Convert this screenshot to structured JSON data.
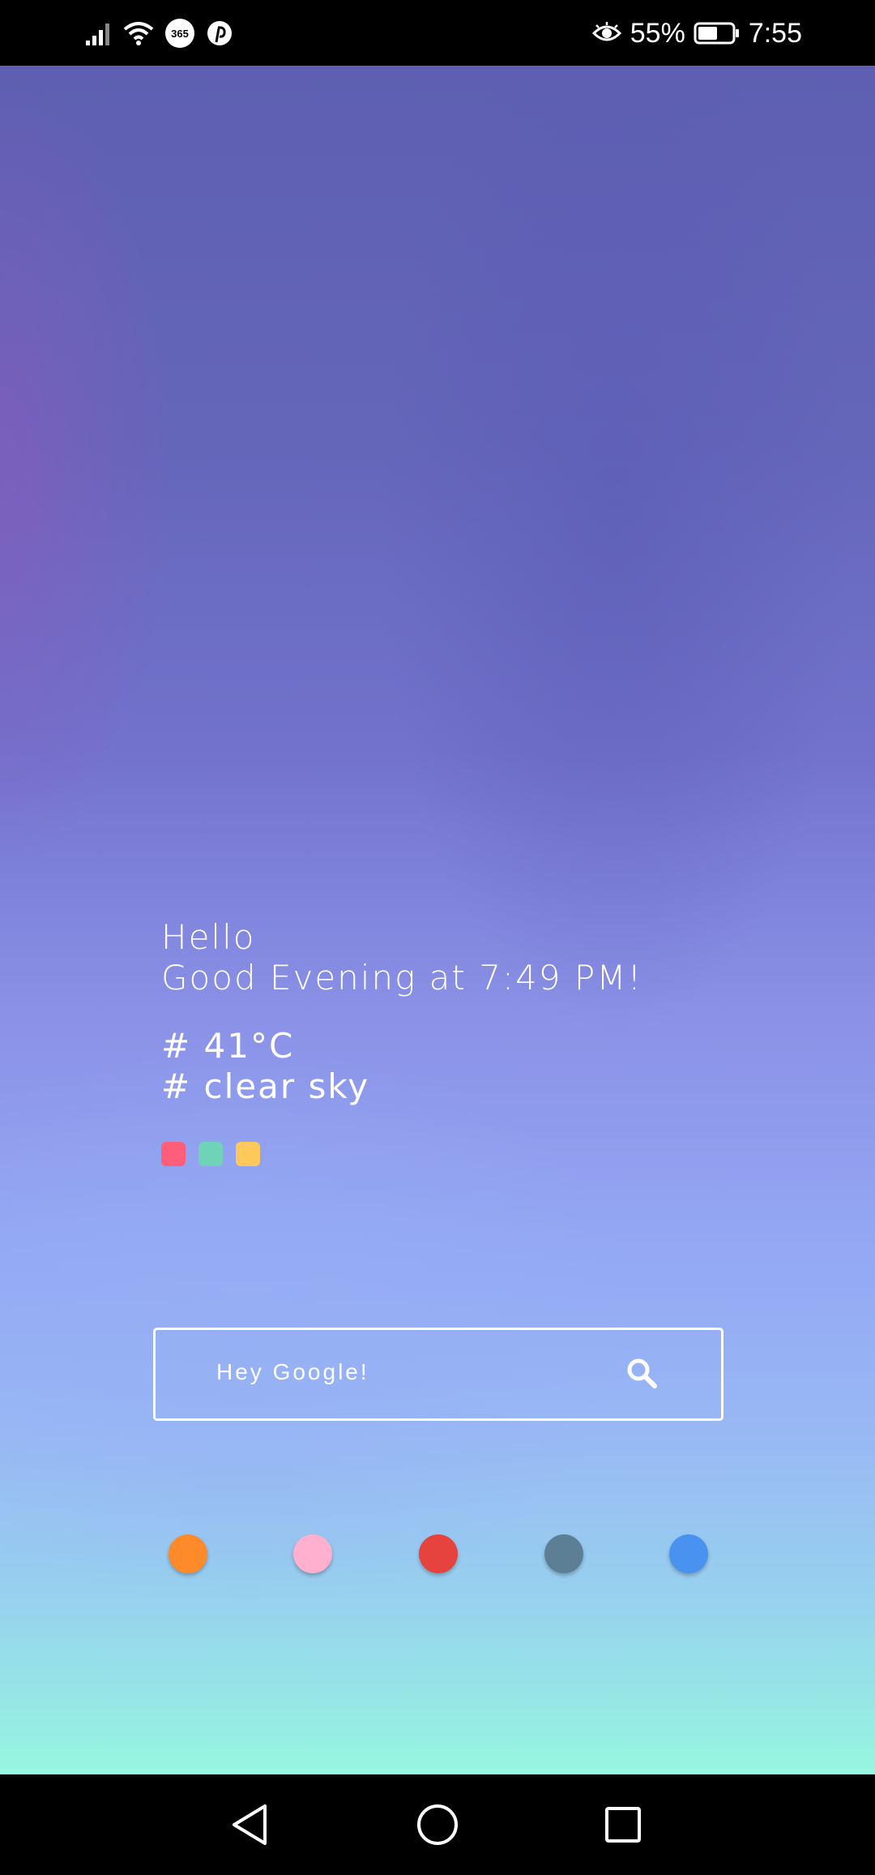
{
  "status_bar": {
    "battery_percent": "55%",
    "time": "7:55",
    "badge_365": "365",
    "icons": [
      "signal-icon",
      "wifi-icon",
      "app-365-icon",
      "pinterest-icon",
      "eye-comfort-icon",
      "battery-icon"
    ],
    "battery_level": 0.55
  },
  "greeting": {
    "line1": "Hello",
    "line2": "Good Evening at 7:49 PM!"
  },
  "weather": {
    "temperature": "# 41°C",
    "condition": "# clear sky"
  },
  "color_dots": [
    "#ff5e7a",
    "#6fd3b8",
    "#ffc85a"
  ],
  "search": {
    "placeholder": "Hey Google!"
  },
  "app_circles": [
    {
      "name": "orange",
      "color": "#ff8a2a"
    },
    {
      "name": "pink",
      "color": "#ffb0cf"
    },
    {
      "name": "red",
      "color": "#e6423e"
    },
    {
      "name": "slate",
      "color": "#5c7f95"
    },
    {
      "name": "blue",
      "color": "#4a92f0"
    }
  ],
  "navbar": {
    "icons": [
      "back-icon",
      "home-icon",
      "recents-icon"
    ]
  }
}
